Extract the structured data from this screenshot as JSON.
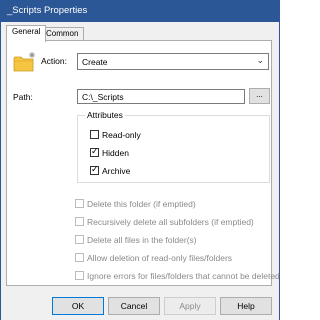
{
  "window": {
    "title": "_Scripts Properties"
  },
  "tabs": [
    {
      "label": "General"
    },
    {
      "label": "Common"
    }
  ],
  "action": {
    "label": "Action:",
    "value": "Create"
  },
  "path": {
    "label": "Path:",
    "value": "C:\\_Scripts",
    "browse_label": "..."
  },
  "attributes": {
    "legend": "Attributes",
    "items": [
      {
        "label": "Read-only",
        "checked": false
      },
      {
        "label": "Hidden",
        "checked": true
      },
      {
        "label": "Archive",
        "checked": true
      }
    ]
  },
  "options": [
    {
      "label": "Delete this folder (if emptied)",
      "checked": false
    },
    {
      "label": "Recursively delete all subfolders (if emptied)",
      "checked": false
    },
    {
      "label": "Delete all files in the folder(s)",
      "checked": false
    },
    {
      "label": "Allow deletion of read-only files/folders",
      "checked": false
    },
    {
      "label": "Ignore errors for files/folders that cannot be deleted",
      "checked": false
    }
  ],
  "buttons": {
    "ok": "OK",
    "cancel": "Cancel",
    "apply": "Apply",
    "help": "Help"
  },
  "icons": {
    "folder": "folder-new-icon",
    "dropdown": "chevron-down-icon",
    "checkmark": "checkmark-icon"
  },
  "colors": {
    "titlebar": "#2b5797",
    "folder_fill": "#f5c542"
  }
}
